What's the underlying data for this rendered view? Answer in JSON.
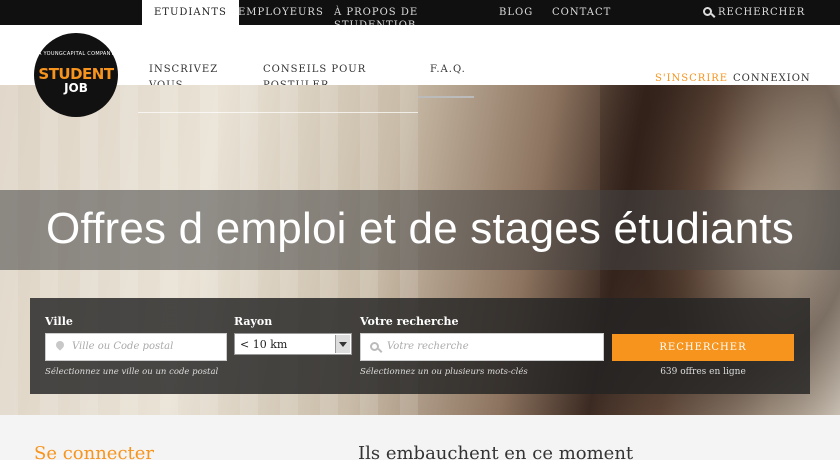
{
  "top_nav": {
    "tabs": [
      {
        "label": "Etudiants",
        "active": true
      },
      {
        "label": "Employeurs"
      },
      {
        "label": "À propos de StudentJob"
      },
      {
        "label": "Blog"
      },
      {
        "label": "Contact"
      }
    ],
    "search_label": "Rechercher"
  },
  "logo": {
    "tagline": "A YOUNGCAPITAL COMPANY",
    "line1": "STUDENT",
    "line2": "JOB"
  },
  "main_nav": {
    "items": [
      {
        "label_line1": "Inscrivez",
        "label_line2": "vous"
      },
      {
        "label_line1": "Conseils pour",
        "label_line2": "postuler"
      },
      {
        "label_line1": "F.A.Q.",
        "label_line2": ""
      }
    ],
    "signup": "S'inscrire",
    "login": "Connexion"
  },
  "hero": {
    "headline": "Offres d emploi et de stages étudiants"
  },
  "search_panel": {
    "city_label": "Ville",
    "city_placeholder": "Ville ou Code postal",
    "city_hint": "Sélectionnez une ville ou un code postal",
    "radius_label": "Rayon",
    "radius_value": "< 10 km",
    "query_label": "Votre recherche",
    "query_placeholder": "Votre recherche",
    "query_hint": "Sélectionnez un ou plusieurs mots-clés",
    "button_label": "Rechercher",
    "offers_count": "639 offres en ligne"
  },
  "bottom": {
    "login_heading": "Se connecter",
    "hiring_heading": "Ils embauchent en ce moment"
  },
  "colors": {
    "accent": "#f7941d",
    "topbar": "#101010"
  }
}
